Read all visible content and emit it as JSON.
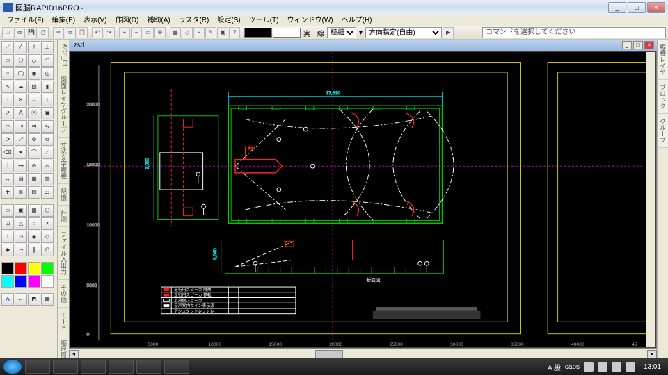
{
  "app": {
    "title": "図脳RAPID16PRO - "
  },
  "menu": [
    "ファイル(F)",
    "編集(E)",
    "表示(V)",
    "作図(D)",
    "補助(A)",
    "ラスタ(R)",
    "設定(S)",
    "ツール(T)",
    "ウィンドウ(W)",
    "ヘルプ(H)"
  ],
  "toolbar2": {
    "linetype_label": "実　線",
    "width_label": "極細",
    "direction_label": "方向指定(自由)"
  },
  "command_hint": "コマンドを選択してください",
  "doc": {
    "filename": ".zsd"
  },
  "left_tabs": [
    "ACE_01",
    "図面レイヤグループ",
    "寸法文字線種",
    "記憶",
    "計測",
    "ファイル入出力",
    "その他",
    "モード",
    "縮尺原点"
  ],
  "right_tabs": [
    "線種レイヤ",
    "ブロック",
    "グループ"
  ],
  "axes": {
    "x": [
      "5000",
      "10000",
      "15000",
      "20000",
      "25000",
      "30000",
      "35000",
      "40000",
      "45"
    ],
    "y": [
      "0",
      "5000",
      "10000",
      "15000",
      "20000"
    ]
  },
  "dims": {
    "width": "17,610",
    "side": "9,050",
    "speaker": "300",
    "section_h": "3,040"
  },
  "labels": {
    "section": "断面図"
  },
  "colors": {
    "border_yellow": "#cccc00",
    "frame_green": "#00c800",
    "accent_red": "#ff2020",
    "dim_cyan": "#00d0d0",
    "guide_magenta": "#c000c0",
    "white": "#ffffff"
  },
  "legend_rows": [
    "走行用スピーカ  降熱",
    "走行用スピーカ  移転",
    "反対側スピーカ",
    "音声案内サイン表示源",
    "アシスタントレファレ"
  ],
  "tray": {
    "ime": "A 般",
    "extra": "caps",
    "clock": "13:01"
  }
}
